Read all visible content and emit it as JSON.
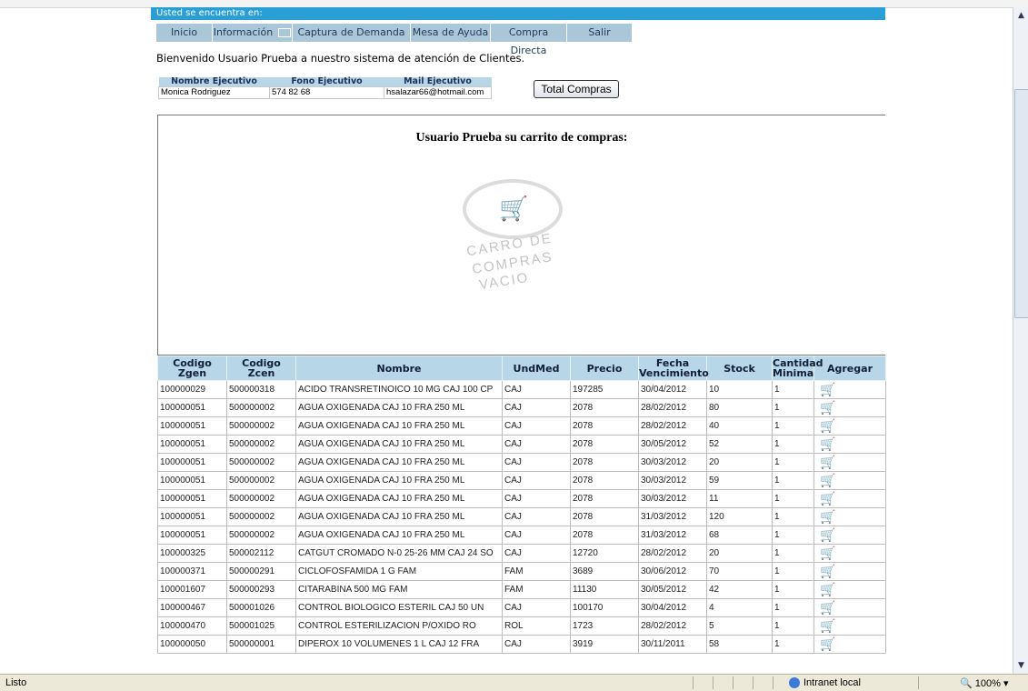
{
  "breadcrumb": "Usted se encuentra en:",
  "nav": {
    "items": [
      "Inicio",
      "Información",
      "Captura de Demanda",
      "Mesa de Ayuda",
      "Compra Directa",
      "Salir"
    ]
  },
  "welcome": "Bienvenido Usuario Prueba a nuestro sistema de atención de Clientes.",
  "executive": {
    "headers": [
      "Nombre Ejecutivo",
      "Fono Ejecutivo",
      "Mail Ejecutivo"
    ],
    "name": "Monica Rodriguez",
    "phone": "574 82 68",
    "mail": "hsalazar66@hotmail.com"
  },
  "total_button": "Total Compras",
  "cart": {
    "title": "Usuario Prueba su carrito de compras:",
    "empty_lines": [
      "CARRO DE",
      "COMPRAS",
      "VACIO"
    ],
    "icon": "shopping-cart-icon"
  },
  "table": {
    "headers": [
      "Codigo Zgen",
      "Codigo Zcen",
      "Nombre",
      "UndMed",
      "Precio",
      "Fecha Vencimiento",
      "Stock",
      "Cantidad Minima",
      "Agregar"
    ],
    "rows": [
      [
        "100000029",
        "500000318",
        "ACIDO TRANSRETINOICO 10 MG CAJ 100 CP",
        "CAJ",
        "197285",
        "30/04/2012",
        "10",
        "1"
      ],
      [
        "100000051",
        "500000002",
        "AGUA OXIGENADA CAJ 10 FRA 250 ML",
        "CAJ",
        "2078",
        "28/02/2012",
        "80",
        "1"
      ],
      [
        "100000051",
        "500000002",
        "AGUA OXIGENADA CAJ 10 FRA 250 ML",
        "CAJ",
        "2078",
        "28/02/2012",
        "40",
        "1"
      ],
      [
        "100000051",
        "500000002",
        "AGUA OXIGENADA CAJ 10 FRA 250 ML",
        "CAJ",
        "2078",
        "30/05/2012",
        "52",
        "1"
      ],
      [
        "100000051",
        "500000002",
        "AGUA OXIGENADA CAJ 10 FRA 250 ML",
        "CAJ",
        "2078",
        "30/03/2012",
        "20",
        "1"
      ],
      [
        "100000051",
        "500000002",
        "AGUA OXIGENADA CAJ 10 FRA 250 ML",
        "CAJ",
        "2078",
        "30/03/2012",
        "59",
        "1"
      ],
      [
        "100000051",
        "500000002",
        "AGUA OXIGENADA CAJ 10 FRA 250 ML",
        "CAJ",
        "2078",
        "30/03/2012",
        "11",
        "1"
      ],
      [
        "100000051",
        "500000002",
        "AGUA OXIGENADA CAJ 10 FRA 250 ML",
        "CAJ",
        "2078",
        "31/03/2012",
        "120",
        "1"
      ],
      [
        "100000051",
        "500000002",
        "AGUA OXIGENADA CAJ 10 FRA 250 ML",
        "CAJ",
        "2078",
        "31/03/2012",
        "68",
        "1"
      ],
      [
        "100000325",
        "500002112",
        "CATGUT CROMADO N-0 25-26 MM CAJ 24 SO",
        "CAJ",
        "12720",
        "28/02/2012",
        "20",
        "1"
      ],
      [
        "100000371",
        "500000291",
        "CICLOFOSFAMIDA 1 G FAM",
        "FAM",
        "3689",
        "30/06/2012",
        "70",
        "1"
      ],
      [
        "100001607",
        "500000293",
        "CITARABINA 500 MG FAM",
        "FAM",
        "11130",
        "30/05/2012",
        "42",
        "1"
      ],
      [
        "100000467",
        "500001026",
        "CONTROL BIOLOGICO ESTERIL CAJ 50 UN",
        "CAJ",
        "100170",
        "30/04/2012",
        "4",
        "1"
      ],
      [
        "100000470",
        "500001025",
        "CONTROL ESTERILIZACION P/OXIDO RO",
        "ROL",
        "1723",
        "28/02/2012",
        "5",
        "1"
      ],
      [
        "100000050",
        "500000001",
        "DIPEROX 10 VOLUMENES 1 L CAJ 12 FRA",
        "CAJ",
        "3919",
        "30/11/2011",
        "58",
        "1"
      ]
    ],
    "row_icon": "add-to-cart-icon"
  },
  "status_bar": {
    "text": "Listo",
    "zone": "Intranet local",
    "zoom": "100%"
  },
  "colors": {
    "breadcrumb_bg": "#2a9fd6",
    "nav_tab_bg": "#a9c7d7",
    "table_header_bg": "#b7d7e8"
  }
}
